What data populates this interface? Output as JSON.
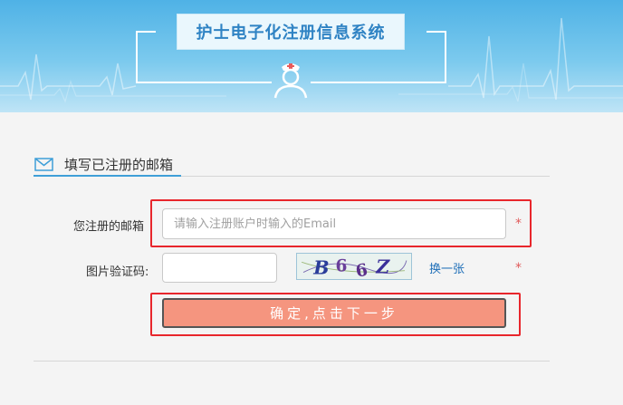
{
  "header": {
    "system_title": "护士电子化注册信息系统",
    "colors": {
      "title_text": "#2f83c4",
      "banner_top": "#4fb2e6",
      "banner_bottom": "#bfe4f6"
    },
    "icon": "nurse-avatar-icon"
  },
  "section": {
    "icon": "mail-icon",
    "title": "填写已注册的邮箱",
    "accent_color": "#3f9fd8"
  },
  "form": {
    "email": {
      "label": "您注册的邮箱",
      "value": "",
      "placeholder": "请输入注册账户时输入的Email",
      "required_mark": "*"
    },
    "captcha": {
      "label": "图片验证码:",
      "value": "",
      "image_text": "B66Z",
      "refresh_label": "换一张",
      "required_mark": "*"
    },
    "submit_label": "确定,点击下一步",
    "submit_color": "#f5957f"
  },
  "highlight_color": "#e8262c"
}
